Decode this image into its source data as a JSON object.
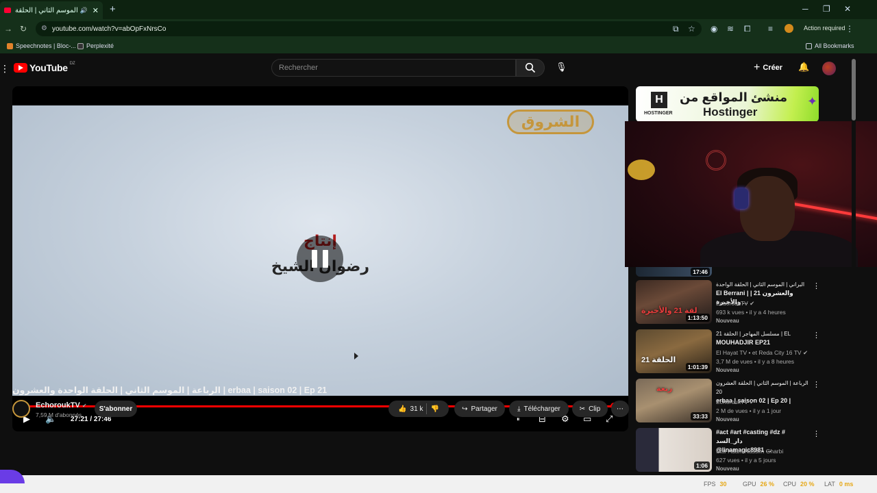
{
  "browser": {
    "tab_title": "الرباعة | الموسم الثاني | الحلقة",
    "tab_close": "✕",
    "new_tab": "+",
    "url": "youtube.com/watch?v=abOpFxNrsCo",
    "action_required": "Action required",
    "bookmarks": [
      "Speechnotes | Bloc-...",
      "Perplexité"
    ],
    "all_bookmarks": "All Bookmarks",
    "win_min": "─",
    "win_restore": "❐",
    "win_close": "✕"
  },
  "youtube": {
    "logo": "YouTube",
    "region": "DZ",
    "search_placeholder": "Rechercher",
    "create": "Créer",
    "player": {
      "channel_logo": "الشروق",
      "credit_line1": "إنتاج",
      "credit_line2": "رضوان الشيخ",
      "time_current": "27:21",
      "time_total": "27:46",
      "time_display": "27:21 / 27:46",
      "progress_fraction": 0.985
    },
    "video_title": "الرباعة | الموسم الثاني | الحلقة الواحدة والعشرون | erbaa | saison 02 | Ep 21",
    "channel": {
      "name": "EchoroukTV",
      "subscribers": "7,59 M d'abonnés",
      "subscribe": "S'abonner"
    },
    "actions": {
      "likes": "31 k",
      "share": "Partager",
      "download": "Télécharger",
      "clip": "Clip"
    },
    "ad": {
      "arabic": "منشئ المواقع من",
      "english": "Hostinger",
      "brand": "HOSTINGER"
    },
    "partial_item_duration": "17:46",
    "sidebar": [
      {
        "title_line1": "البراني | الموسم الثاني | الحلقة الواحدة",
        "title_line2": "El Berrani | | 21 والعشرون والأخيرة ...",
        "channel": "EchoroukTV",
        "meta": "693 k vues • il y a 4 heures",
        "badge": "Nouveau",
        "duration": "1:13:50",
        "thumb_text": "لقة 21 والأخيرة"
      },
      {
        "title_line1": "مسلسل المهاجر | الحلقة 21 | EL",
        "title_line2": "MOUHADJIR EP21",
        "channel": "El Hayat TV • et Reda City 16 TV",
        "meta": "3,7 M de vues • il y a 8 heures",
        "badge": "Nouveau",
        "duration": "1:01:39",
        "thumb_text": "الحلقة 21"
      },
      {
        "title_line1": "الرباعة | الموسم الثاني | الحلقة العشرون 20",
        "title_line2": "erbaa | saison 02 | Ep 20 |",
        "channel": "EchoroukTV",
        "meta": "2 M de vues • il y a 1 jour",
        "badge": "Nouveau",
        "duration": "33:33",
        "thumb_text": "ربعة"
      },
      {
        "title_line1": "#act #art #casting #dz # دار_السد",
        "title_line2": "@linamagic8981 ...",
        "channel": "Star Adam Nassim Gharbi",
        "meta": "627 vues • il y a 5 jours",
        "badge": "Nouveau",
        "duration": "1:06",
        "thumb_text": ""
      }
    ]
  },
  "stats": {
    "fps_label": "FPS",
    "fps": "30",
    "gpu_label": "GPU",
    "gpu": "26 %",
    "cpu_label": "CPU",
    "cpu": "20 %",
    "lat_label": "LAT",
    "lat": "0 ms"
  }
}
